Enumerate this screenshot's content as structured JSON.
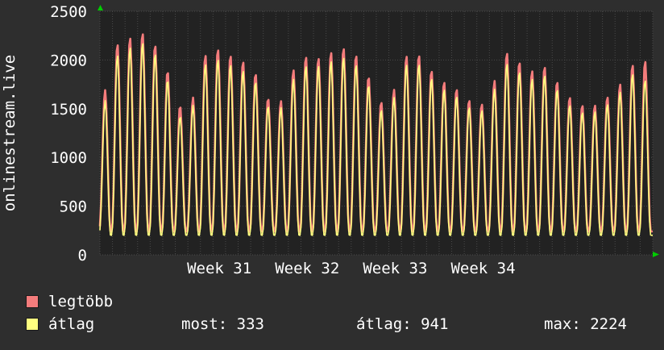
{
  "chart_data": {
    "type": "area",
    "ylabel": "onlinestream.live",
    "ylim": [
      0,
      2500
    ],
    "yticks": [
      0,
      500,
      1000,
      1500,
      2000,
      2500
    ],
    "xticks": [
      "Week 31",
      "Week 32",
      "Week 33",
      "Week 34"
    ],
    "grid": true,
    "day_index_range": [
      0,
      44
    ],
    "series": [
      {
        "name": "legtöbb",
        "color": "#f47c7c",
        "peaks": [
          1380,
          2160,
          2180,
          2320,
          2230,
          2050,
          1640,
          1360,
          2000,
          2140,
          2080,
          2010,
          1960,
          1720,
          1440,
          1800,
          2060,
          2010,
          2050,
          2140,
          2110,
          1970,
          1620,
          1500,
          2000,
          2120,
          1960,
          1800,
          1750,
          1640,
          1520,
          1600,
          2080,
          2080,
          1840,
          1980,
          1870,
          1650,
          1580,
          1480,
          1630,
          1620,
          1960,
          1950,
          2060
        ]
      },
      {
        "name": "átlag",
        "color": "#ffff80",
        "peaks": [
          1280,
          2040,
          2080,
          2224,
          2130,
          1980,
          1520,
          1280,
          1920,
          2030,
          1990,
          1910,
          1880,
          1630,
          1380,
          1720,
          1950,
          1940,
          1960,
          2050,
          2010,
          1880,
          1540,
          1420,
          1920,
          2020,
          1880,
          1720,
          1680,
          1560,
          1460,
          1530,
          1970,
          1970,
          1760,
          1890,
          1790,
          1570,
          1500,
          1420,
          1560,
          1540,
          1880,
          1840,
          1740
        ]
      }
    ],
    "stats": {
      "now_label": "most:",
      "now": "333",
      "avg_label": "átlag:",
      "avg": "941",
      "max_label": "max:",
      "max": "2224"
    },
    "colors": {
      "background": "#2e2e2e",
      "plot_background": "#222222",
      "grid": "#4a4a4a",
      "axis_arrow": "#00cc00"
    }
  }
}
